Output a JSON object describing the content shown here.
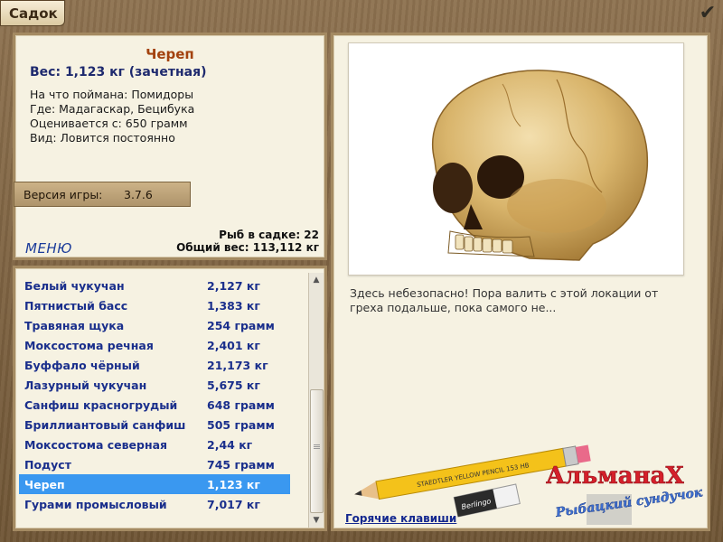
{
  "window": {
    "title": "Садок"
  },
  "fish": {
    "name": "Череп",
    "weight_line": "Вес: 1,123 кг (зачетная)",
    "details": [
      "На что поймана: Помидоры",
      "Где: Мадагаскар, Бецибука",
      "Оценивается с: 650 грамм",
      "Вид: Ловится постоянно"
    ]
  },
  "version": {
    "label": "Версия игры:",
    "value": "3.7.6"
  },
  "menu": {
    "label": "МЕНЮ"
  },
  "stats": {
    "count_line": "Рыб в садке: 22",
    "total_line": "Общий вес: 113,112 кг"
  },
  "fish_list": [
    {
      "name": "Белый чукучан",
      "weight": "2,127 кг"
    },
    {
      "name": "Пятнистый басс",
      "weight": "1,383 кг"
    },
    {
      "name": "Травяная щука",
      "weight": "254 грамм"
    },
    {
      "name": "Моксостома речная",
      "weight": "2,401 кг"
    },
    {
      "name": "Буффало чёрный",
      "weight": "21,173 кг"
    },
    {
      "name": "Лазурный чукучан",
      "weight": "5,675 кг"
    },
    {
      "name": "Санфиш красногрудый",
      "weight": "648 грамм"
    },
    {
      "name": "Бриллиантовый санфиш",
      "weight": "505 грамм"
    },
    {
      "name": "Моксостома северная",
      "weight": "2,44 кг"
    },
    {
      "name": "Подуст",
      "weight": "745 грамм"
    },
    {
      "name": "Череп",
      "weight": "1,123 кг",
      "selected": true
    },
    {
      "name": "Гурами промысловый",
      "weight": "7,017 кг"
    }
  ],
  "description": "Здесь небезопасно! Пора валить с этой локации от греха подальше, пока самого не...",
  "hotkeys": {
    "label": "Горячие клавиши"
  },
  "almanac": {
    "title": "АльманаХ",
    "subtitle": "Рыбацкий сундучок",
    "pencil_text": "STAEDTLER YELLOW PENCIL 153 HB",
    "eraser_text": "Berlingo"
  },
  "colors": {
    "accent_selected": "#3a98f0",
    "fish_name": "#a3420e",
    "list_text": "#1a2f8c"
  }
}
